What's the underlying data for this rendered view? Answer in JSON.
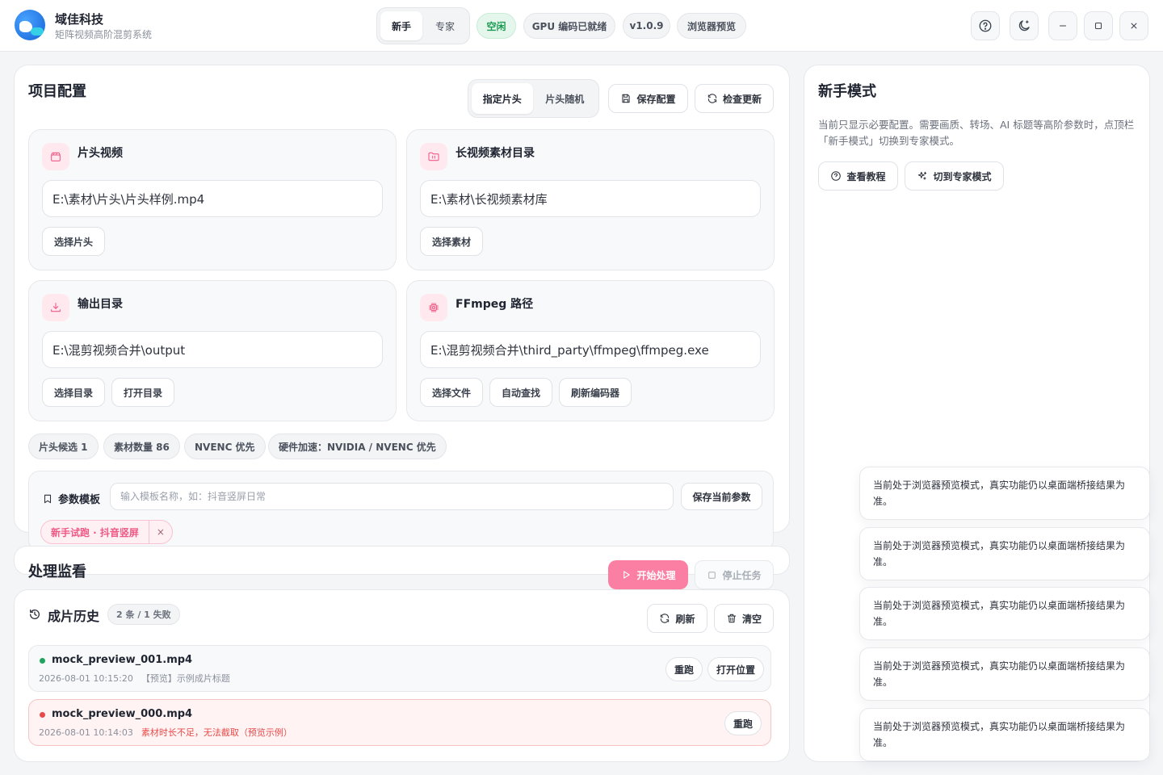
{
  "app": {
    "name": "域佳科技",
    "subtitle": "矩阵视频高阶混剪系统"
  },
  "mode_switch": {
    "novice": "新手",
    "expert": "专家",
    "active": "novice"
  },
  "status_pills": [
    "空闲",
    "GPU 编码已就绪",
    "v1.0.9",
    "浏览器预览"
  ],
  "window_controls": [
    "help-icon",
    "moon-icon",
    "minimize-icon",
    "maximize-icon",
    "close-icon"
  ],
  "project": {
    "title": "项目配置",
    "head_modes": [
      "指定片头",
      "片头随机"
    ],
    "save_label": "保存配置",
    "update_label": "检查更新",
    "cards": [
      {
        "title": "片头视频",
        "icon": "clapper-icon",
        "value": "E:\\素材\\片头\\片头样例.mp4",
        "buttons": [
          "选择片头"
        ]
      },
      {
        "title": "长视频素材目录",
        "icon": "folder-icon",
        "value": "E:\\素材\\长视频素材库",
        "buttons": [
          "选择素材"
        ]
      },
      {
        "title": "输出目录",
        "icon": "download-icon",
        "value": "E:\\混剪视频合并\\output",
        "buttons": [
          "选择目录",
          "打开目录"
        ]
      },
      {
        "title": "FFmpeg 路径",
        "icon": "chip-icon",
        "value": "E:\\混剪视频合并\\third_party\\ffmpeg\\ffmpeg.exe",
        "buttons": [
          "选择文件",
          "自动查找",
          "刷新编码器"
        ]
      }
    ],
    "tags": [
      "片头候选 1",
      "素材数量 86",
      "NVENC 优先",
      "硬件加速：NVIDIA / NVENC 优先"
    ],
    "template": {
      "label": "参数模板",
      "placeholder": "输入模板名称，如：抖音竖屏日常",
      "save_label": "保存当前参数",
      "chip": "新手试跑 · 抖音竖屏",
      "chip_close": "×"
    }
  },
  "monitor": {
    "title": "处理监看",
    "start_label": "开始处理",
    "stop_label": "停止任务"
  },
  "history": {
    "title": "成片历史",
    "count": "2 条 / 1 失败",
    "refresh_label": "刷新",
    "clear_label": "清空",
    "rows": [
      {
        "name": "mock_preview_001.mp4",
        "time": "2026-08-01 10:15:20",
        "note": "【预览】示例成片标题",
        "status": "success",
        "actions": [
          "重跑",
          "打开位置"
        ]
      },
      {
        "name": "mock_preview_000.mp4",
        "time": "2026-08-01 10:14:03",
        "error": "素材时长不足，无法截取（预览示例）",
        "status": "failed",
        "actions": [
          "重跑"
        ]
      }
    ]
  },
  "novice": {
    "title": "新手模式",
    "text": "当前只显示必要配置。需要画质、转场、AI 标题等高阶参数时，点顶栏「新手模式」切换到专家模式。",
    "tutorial_label": "查看教程",
    "switch_label": "切到专家模式"
  },
  "toasts": [
    "当前处于浏览器预览模式，真实功能仍以桌面端桥接结果为准。",
    "当前处于浏览器预览模式，真实功能仍以桌面端桥接结果为准。",
    "当前处于浏览器预览模式，真实功能仍以桌面端桥接结果为准。",
    "当前处于浏览器预览模式，真实功能仍以桌面端桥接结果为准。",
    "当前处于浏览器预览模式，真实功能仍以桌面端桥接结果为准。"
  ],
  "colors": {
    "accent": "#fb7ea3",
    "success": "#1fa45c",
    "danger": "#e84a4a",
    "idle": "#1d9b54"
  }
}
